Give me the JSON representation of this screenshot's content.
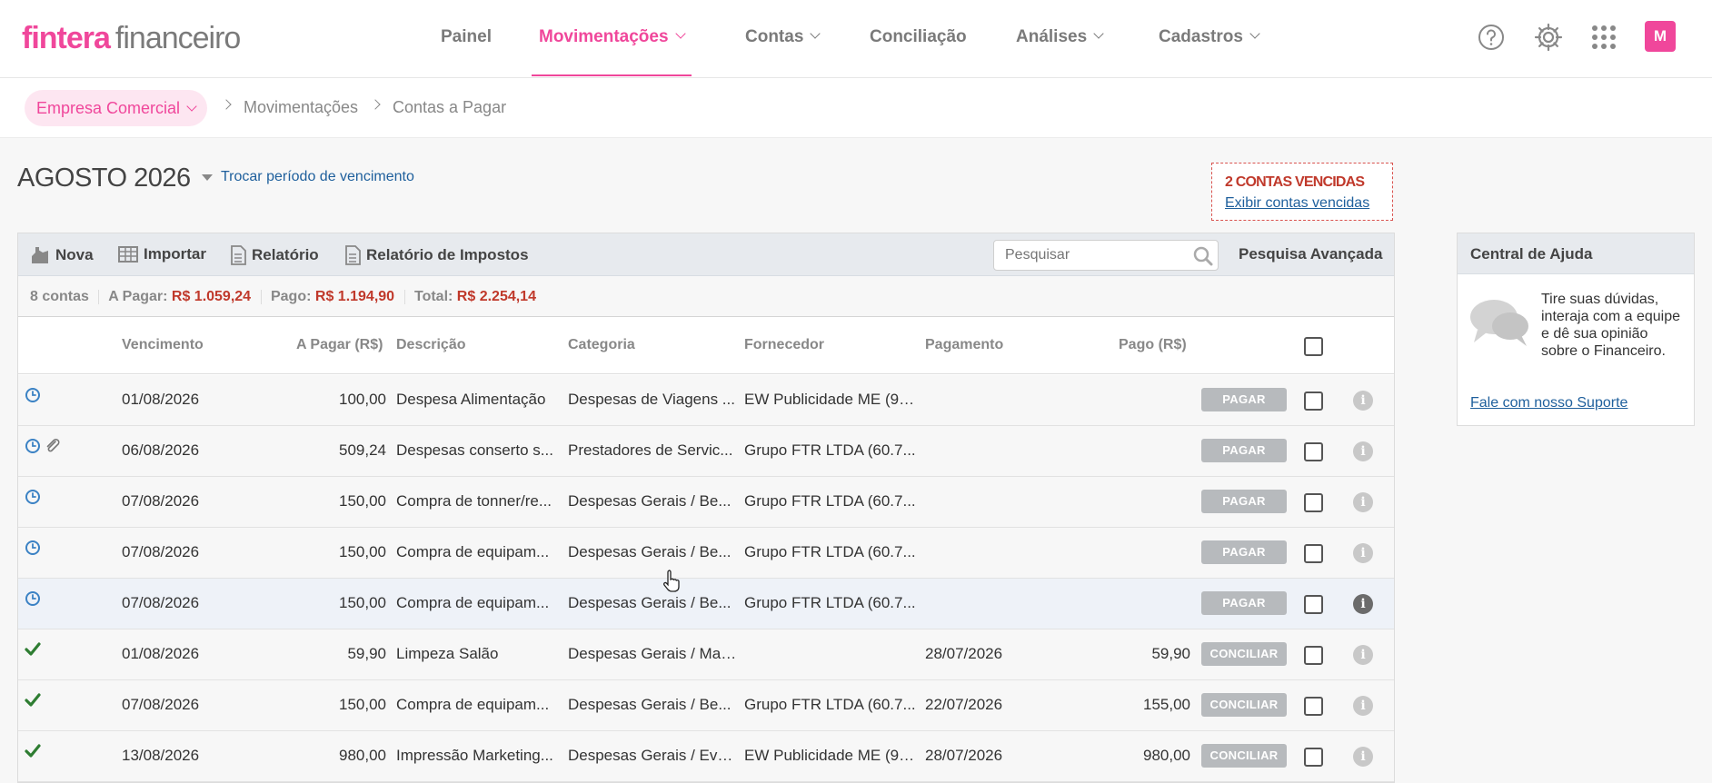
{
  "brand": {
    "name": "fintera",
    "product": "financeiro",
    "accent": "#f0479b"
  },
  "nav": {
    "painel": "Painel",
    "movimentacoes": "Movimentações",
    "contas": "Contas",
    "conciliacao": "Conciliação",
    "analises": "Análises",
    "cadastros": "Cadastros",
    "avatar": "M"
  },
  "breadcrumb": {
    "company": "Empresa Comercial",
    "level1": "Movimentações",
    "level2": "Contas a Pagar"
  },
  "period": {
    "label": "AGOSTO 2026",
    "change_link": "Trocar período de vencimento"
  },
  "overdue": {
    "title": "2 CONTAS VENCIDAS",
    "link": "Exibir contas vencidas"
  },
  "toolbar": {
    "nova": "Nova",
    "importar": "Importar",
    "relatorio": "Relatório",
    "relatorio_impostos": "Relatório de Impostos",
    "search_placeholder": "Pesquisar",
    "advanced": "Pesquisa Avançada"
  },
  "summary": {
    "count": "8 contas",
    "a_pagar_label": "A Pagar:",
    "a_pagar_value": "R$ 1.059,24",
    "pago_label": "Pago:",
    "pago_value": "R$ 1.194,90",
    "total_label": "Total:",
    "total_value": "R$ 2.254,14"
  },
  "columns": {
    "vencimento": "Vencimento",
    "a_pagar": "A Pagar (R$)",
    "descricao": "Descrição",
    "categoria": "Categoria",
    "fornecedor": "Fornecedor",
    "pagamento": "Pagamento",
    "pago": "Pago (R$)"
  },
  "rows": [
    {
      "status": "clock-icon",
      "vencimento": "01/08/2026",
      "a_pagar": "100,00",
      "descricao": "Despesa Alimentação",
      "categoria": "Despesas de Viagens ...",
      "fornecedor": "EW Publicidade ME (98...",
      "pagamento": "",
      "pago": "",
      "action": "PAGAR"
    },
    {
      "status": "clock-icon",
      "attachment": true,
      "vencimento": "06/08/2026",
      "a_pagar": "509,24",
      "descricao": "Despesas conserto s...",
      "categoria": "Prestadores de Servic...",
      "fornecedor": "Grupo FTR LTDA (60.7...",
      "pagamento": "",
      "pago": "",
      "action": "PAGAR"
    },
    {
      "status": "clock-icon",
      "vencimento": "07/08/2026",
      "a_pagar": "150,00",
      "descricao": "Compra de tonner/re...",
      "categoria": "Despesas Gerais / Be...",
      "fornecedor": "Grupo FTR LTDA (60.7...",
      "pagamento": "",
      "pago": "",
      "action": "PAGAR"
    },
    {
      "status": "clock-icon",
      "vencimento": "07/08/2026",
      "a_pagar": "150,00",
      "descricao": "Compra de equipam...",
      "categoria": "Despesas Gerais / Be...",
      "fornecedor": "Grupo FTR LTDA (60.7...",
      "pagamento": "",
      "pago": "",
      "action": "PAGAR"
    },
    {
      "status": "clock-icon",
      "highlight": true,
      "vencimento": "07/08/2026",
      "a_pagar": "150,00",
      "descricao": "Compra de equipam...",
      "categoria": "Despesas Gerais / Be...",
      "fornecedor": "Grupo FTR LTDA (60.7...",
      "pagamento": "",
      "pago": "",
      "action": "PAGAR"
    },
    {
      "status": "check-icon",
      "vencimento": "01/08/2026",
      "a_pagar": "59,90",
      "descricao": "Limpeza Salão",
      "categoria": "Despesas Gerais / Mat...",
      "fornecedor": "",
      "pagamento": "28/07/2026",
      "pago": "59,90",
      "action": "CONCILIAR"
    },
    {
      "status": "check-icon",
      "vencimento": "07/08/2026",
      "a_pagar": "150,00",
      "descricao": "Compra de equipam...",
      "categoria": "Despesas Gerais / Be...",
      "fornecedor": "Grupo FTR LTDA (60.7...",
      "pagamento": "22/07/2026",
      "pago": "155,00",
      "action": "CONCILIAR"
    },
    {
      "status": "check-icon",
      "vencimento": "13/08/2026",
      "a_pagar": "980,00",
      "descricao": "Impressão Marketing...",
      "categoria": "Despesas Gerais / Eve...",
      "fornecedor": "EW Publicidade ME (98...",
      "pagamento": "28/07/2026",
      "pago": "980,00",
      "action": "CONCILIAR"
    }
  ],
  "help": {
    "title": "Central de Ajuda",
    "text": "Tire suas dúvidas, interaja com a equipe e dê sua opinião sobre o Financeiro.",
    "link": "Fale com nosso Suporte"
  },
  "colors": {
    "danger": "#c0392b",
    "link": "#1e5f9c",
    "check": "#2e7d32",
    "clock": "#3b82c4"
  }
}
